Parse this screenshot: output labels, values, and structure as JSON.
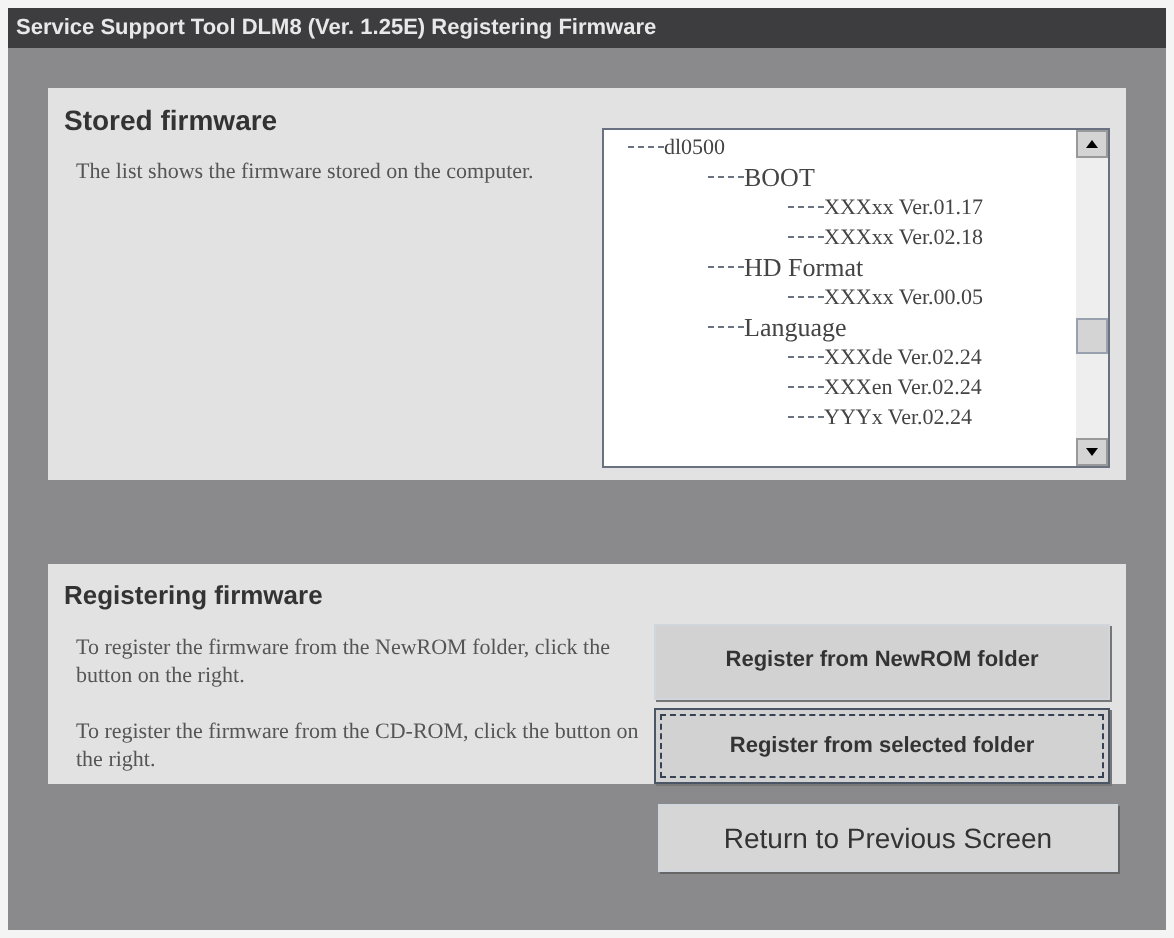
{
  "window": {
    "title": "Service Support Tool DLM8 (Ver. 1.25E)  Registering Firmware"
  },
  "stored": {
    "title": "Stored firmware",
    "description": "The list shows the firmware stored on the computer.",
    "tree": [
      {
        "label": "dl0500",
        "children": [
          {
            "label": "BOOT",
            "children": [
              {
                "label": "XXXxx Ver.01.17"
              },
              {
                "label": "XXXxx Ver.02.18"
              }
            ]
          },
          {
            "label": "HD Format",
            "children": [
              {
                "label": "XXXxx Ver.00.05"
              }
            ]
          },
          {
            "label": "Language",
            "children": [
              {
                "label": "XXXde Ver.02.24"
              },
              {
                "label": "XXXen Ver.02.24"
              },
              {
                "label": "YYYx Ver.02.24"
              }
            ]
          }
        ]
      }
    ]
  },
  "registering": {
    "title": "Registering firmware",
    "rows": [
      {
        "description": "To register the firmware from the NewROM folder, click the button on the right.",
        "button": "Register from NewROM folder",
        "focused": false
      },
      {
        "description": "To register the firmware from the CD-ROM, click the button on the right.",
        "button": "Register from selected folder",
        "focused": true
      }
    ]
  },
  "return_button": "Return to Previous Screen"
}
